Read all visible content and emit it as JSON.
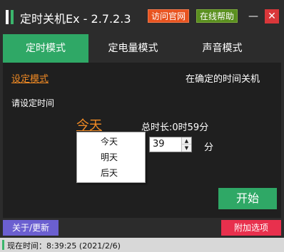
{
  "window": {
    "title": "定时关机Ex - 2.7.2.3",
    "visit_site_label": "访问官网",
    "online_help_label": "在线帮助",
    "minimize_glyph": "—",
    "close_glyph": "✕"
  },
  "tabs": [
    {
      "label": "定时模式",
      "active": true
    },
    {
      "label": "定电量模式",
      "active": false
    },
    {
      "label": "声音模式",
      "active": false
    }
  ],
  "main": {
    "mode_link": "设定模式",
    "mode_description": "在确定的时间关机",
    "prompt": "请设定时间",
    "day_value": "今天",
    "total_duration": "总时长:0时59分",
    "day_options": [
      "今天",
      "明天",
      "后天"
    ],
    "minute_value": "39",
    "minute_unit": "分",
    "start_label": "开始"
  },
  "footer": {
    "about_label": "关于/更新",
    "extra_options_label": "附加选项",
    "status_text": "现在时间：8:39:25 (2021/2/6)"
  },
  "colors": {
    "accent_green": "#2fa866",
    "link_orange": "#f08a24",
    "site_button": "#e8531f",
    "help_button": "#5a8f1f",
    "about_button": "#6b5fd0",
    "extra_button": "#e8304d",
    "close_button": "#d9373a"
  },
  "icons": {
    "app_icon": "app-icon",
    "spinner_up": "triangle-up-icon",
    "spinner_down": "triangle-down-icon"
  }
}
